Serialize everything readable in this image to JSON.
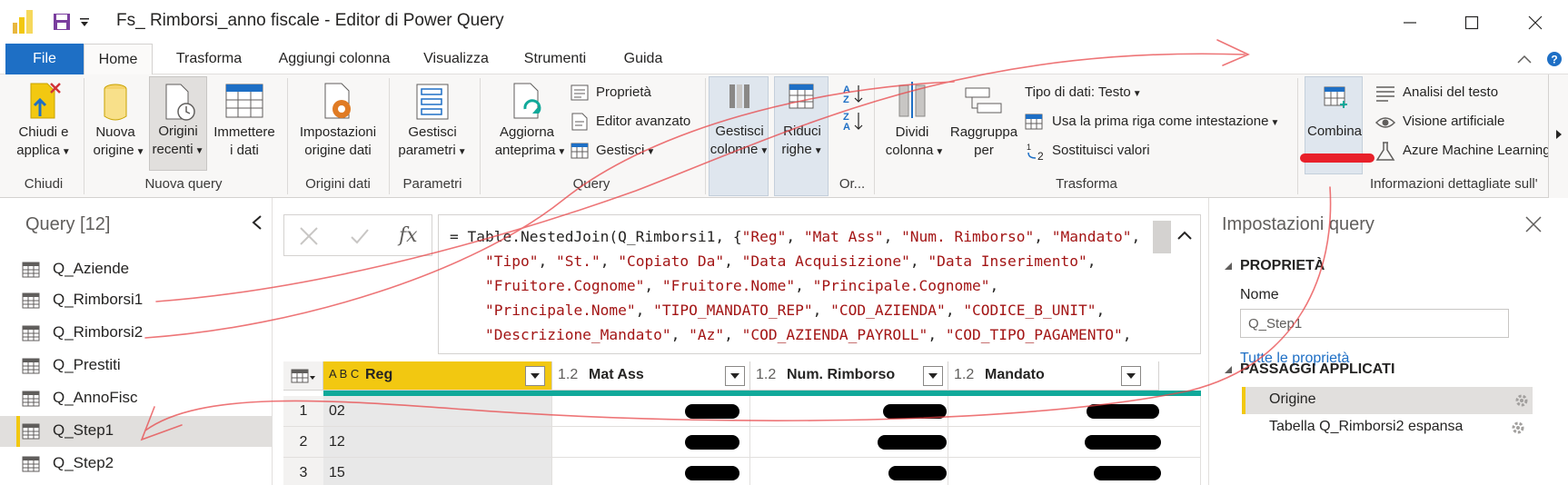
{
  "window": {
    "title": "Fs_ Rimborsi_anno fiscale - Editor di Power Query"
  },
  "menu": {
    "tabs": [
      "File",
      "Home",
      "Trasforma",
      "Aggiungi colonna",
      "Visualizza",
      "Strumenti",
      "Guida"
    ]
  },
  "ribbon": {
    "groups": {
      "chiudi": "Chiudi",
      "nuova_query": "Nuova query",
      "origini_dati": "Origini dati",
      "parametri": "Parametri",
      "query": "Query",
      "or": "Or...",
      "trasforma": "Trasforma",
      "info": "Informazioni dettagliate sull'"
    },
    "buttons": {
      "chiudi_applica": [
        "Chiudi e",
        "applica"
      ],
      "nuova_origine": [
        "Nuova",
        "origine"
      ],
      "origini_recenti": [
        "Origini",
        "recenti"
      ],
      "immettere_dati": [
        "Immettere",
        "i dati"
      ],
      "impostazioni_origine": [
        "Impostazioni",
        "origine dati"
      ],
      "gestisci_parametri": [
        "Gestisci",
        "parametri"
      ],
      "aggiorna_anteprima": [
        "Aggiorna",
        "anteprima"
      ],
      "proprieta": "Proprietà",
      "editor_avanzato": "Editor avanzato",
      "gestisci": "Gestisci",
      "gestisci_colonne": [
        "Gestisci",
        "colonne"
      ],
      "riduci_righe": [
        "Riduci",
        "righe"
      ],
      "dividi_colonna": [
        "Dividi",
        "colonna"
      ],
      "raggruppa_per": [
        "Raggruppa",
        "per"
      ],
      "tipo_dati": "Tipo di dati: Testo",
      "prima_riga": "Usa la prima riga come intestazione",
      "sostituisci": "Sostituisci valori",
      "combina": "Combina",
      "analisi_testo": "Analisi del testo",
      "visione": "Visione artificiale",
      "azure": "Azure Machine Learning"
    }
  },
  "queries": {
    "header": "Query [12]",
    "items": [
      "Q_Aziende",
      "Q_Rimborsi1",
      "Q_Rimborsi2",
      "Q_Prestiti",
      "Q_AnnoFisc",
      "Q_Step1",
      "Q_Step2"
    ],
    "selected": "Q_Step1"
  },
  "formula": {
    "prefix": "= Table.NestedJoin(Q_Rimborsi1, {",
    "line1": [
      "\"Reg\"",
      "\"Mat Ass\"",
      "\"Num. Rimborso\"",
      "\"Mandato\""
    ],
    "line2": [
      "\"Tipo\"",
      "\"St.\"",
      "\"Copiato Da\"",
      "\"Data Acquisizione\"",
      "\"Data Inserimento\""
    ],
    "line3": [
      "\"Fruitore.Cognome\"",
      "\"Fruitore.Nome\"",
      "\"Principale.Cognome\""
    ],
    "line4": [
      "\"Principale.Nome\"",
      "\"TIPO_MANDATO_REP\"",
      "\"COD_AZIENDA\"",
      "\"CODICE_B_UNIT\""
    ],
    "line5": [
      "\"Descrizione_Mandato\"",
      "\"Az\"",
      "\"COD_AZIENDA_PAYROLL\"",
      "\"COD_TIPO_PAGAMENTO\""
    ]
  },
  "grid": {
    "columns": [
      {
        "type": "A B C",
        "name": "Reg"
      },
      {
        "type": "1.2",
        "name": "Mat Ass"
      },
      {
        "type": "1.2",
        "name": "Num. Rimborso"
      },
      {
        "type": "1.2",
        "name": "Mandato"
      }
    ],
    "rows": [
      {
        "n": "1",
        "reg": "02"
      },
      {
        "n": "2",
        "reg": "12"
      },
      {
        "n": "3",
        "reg": "15"
      }
    ]
  },
  "settings": {
    "title": "Impostazioni query",
    "props_header": "PROPRIETÀ",
    "name_label": "Nome",
    "name_value": "Q_Step1",
    "all_props": "Tutte le proprietà",
    "steps_header": "PASSAGGI APPLICATI",
    "steps": [
      "Origine",
      "Tabella Q_Rimborsi2 espansa"
    ]
  },
  "colors": {
    "accent": "#1e6fc5",
    "selection": "#f2c811",
    "quality": "#10a99a",
    "annotation": "#e8474a"
  }
}
